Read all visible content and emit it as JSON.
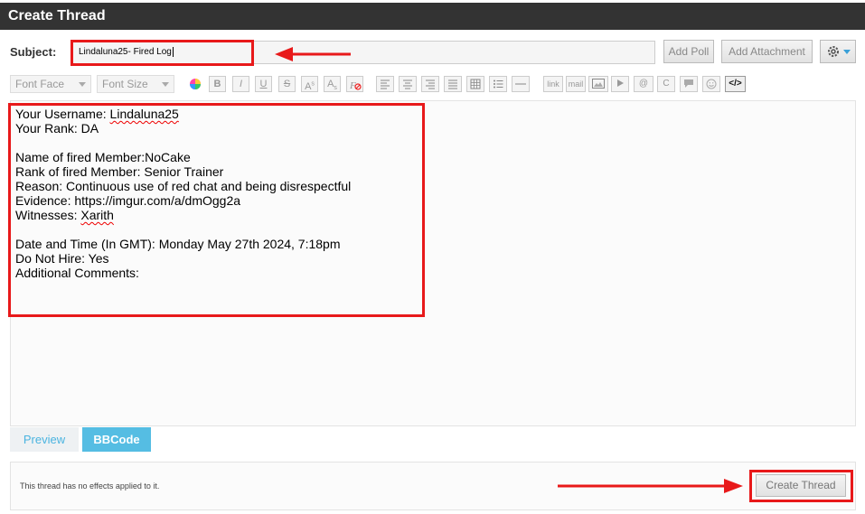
{
  "header": {
    "title": "Create Thread"
  },
  "subject": {
    "label": "Subject:",
    "value": "Lindaluna25- Fired Log"
  },
  "buttons": {
    "add_poll": "Add Poll",
    "add_attachment": "Add Attachment",
    "settings_icon": "gear-icon",
    "create_thread": "Create Thread"
  },
  "toolbar": {
    "font_face": "Font Face",
    "font_size": "Font Size",
    "link": "link",
    "mail": "mail",
    "source_label": "</>"
  },
  "editor": {
    "lines": [
      "Your Username: Lindaluna25",
      "Your Rank: DA",
      "",
      "Name of fired Member:NoCake",
      "Rank of fired Member: Senior Trainer",
      "Reason: Continuous use of red chat and being disrespectful",
      "Evidence: https://imgur.com/a/dmOgg2a",
      "Witnesses: Xarith",
      "",
      "Date and Time (In GMT): Monday May 27th 2024, 7:18pm",
      "Do Not Hire: Yes",
      "Additional Comments:"
    ]
  },
  "tabs": {
    "preview": "Preview",
    "bbcode": "BBCode"
  },
  "footer": {
    "effects_text": "This thread has no effects applied to it."
  },
  "colors": {
    "highlight": "#e8191a",
    "header_bg": "#333333",
    "accent": "#55bde3"
  }
}
